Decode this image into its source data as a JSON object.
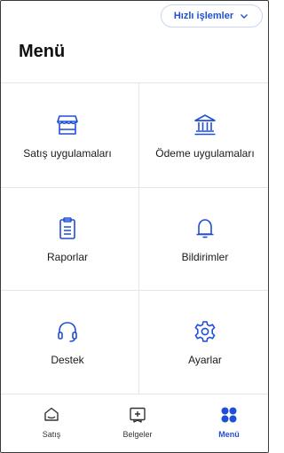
{
  "header": {
    "quick_actions_label": "Hızlı işlemler",
    "title": "Menü"
  },
  "menu": {
    "items": [
      {
        "label": "Satış uygulamaları",
        "icon": "storefront-icon"
      },
      {
        "label": "Ödeme uygulamaları",
        "icon": "bank-icon"
      },
      {
        "label": "Raporlar",
        "icon": "clipboard-icon"
      },
      {
        "label": "Bildirimler",
        "icon": "bell-icon"
      },
      {
        "label": "Destek",
        "icon": "headset-icon"
      },
      {
        "label": "Ayarlar",
        "icon": "gear-icon"
      }
    ]
  },
  "bottom_nav": {
    "items": [
      {
        "label": "Satış",
        "icon": "sales-icon",
        "active": false
      },
      {
        "label": "Belgeler",
        "icon": "documents-icon",
        "active": false
      },
      {
        "label": "Menü",
        "icon": "menu-grid-icon",
        "active": true
      }
    ]
  },
  "colors": {
    "accent": "#1f4fd6",
    "divider": "#e3e6ea",
    "text": "#1a1a1a"
  }
}
